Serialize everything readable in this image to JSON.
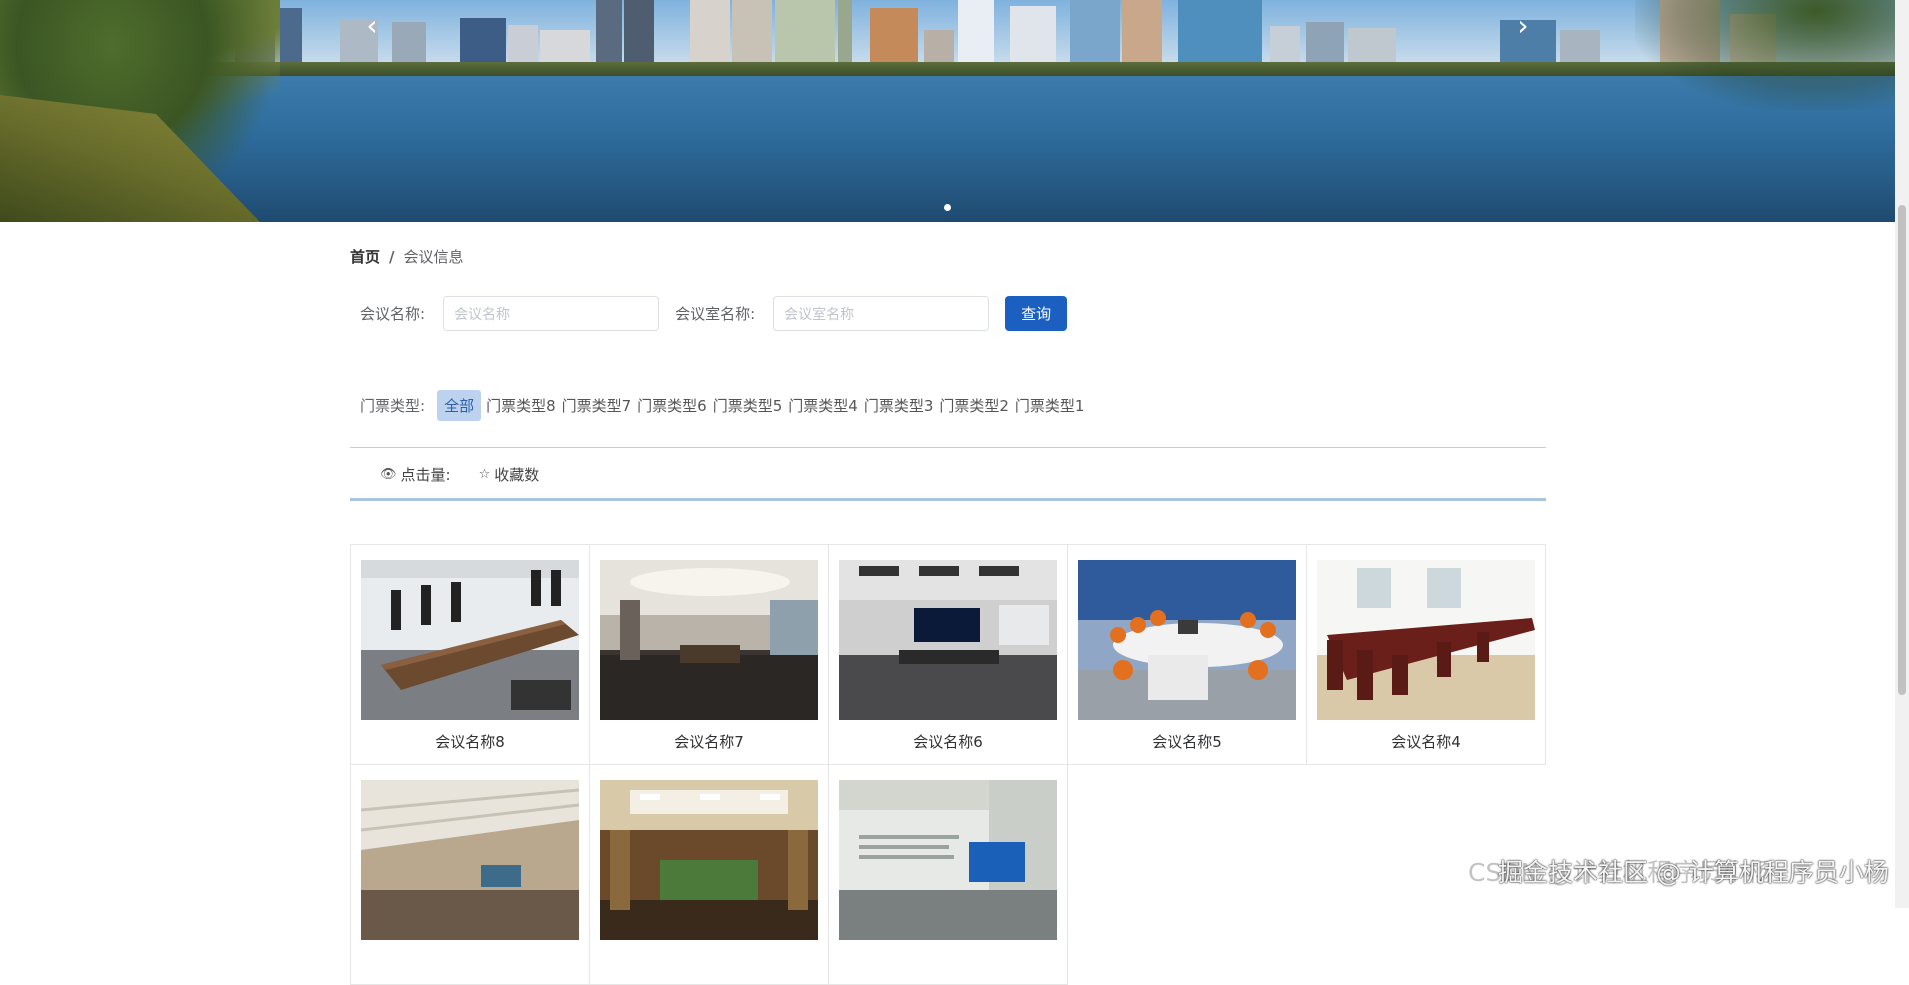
{
  "banner": {
    "prev_icon": "chevron-left-icon",
    "next_icon": "chevron-right-icon",
    "slide_count": 1,
    "active_slide": 1
  },
  "breadcrumb": {
    "home": "首页",
    "separator": "/",
    "current": "会议信息"
  },
  "search": {
    "meeting_name_label": "会议名称:",
    "meeting_name_placeholder": "会议名称",
    "room_name_label": "会议室名称:",
    "room_name_placeholder": "会议室名称",
    "query_button": "查询"
  },
  "filter": {
    "label": "门票类型:",
    "items": [
      "全部",
      "门票类型8",
      "门票类型7",
      "门票类型6",
      "门票类型5",
      "门票类型4",
      "门票类型3",
      "门票类型2",
      "门票类型1"
    ],
    "active": "全部"
  },
  "sort": {
    "clicks": "点击量:",
    "favorites": "收藏数",
    "clicks_icon": "eye-icon",
    "favorites_icon": "star-outline-icon"
  },
  "cards": [
    {
      "name": "会议名称8"
    },
    {
      "name": "会议名称7"
    },
    {
      "name": "会议名称6"
    },
    {
      "name": "会议名称5"
    },
    {
      "name": "会议名称4"
    },
    {
      "name": ""
    },
    {
      "name": ""
    },
    {
      "name": ""
    }
  ],
  "watermark": {
    "text": "掘金技术社区 @ 计算机程序员小杨",
    "shadow": "CSDN @计算机程序员小杨"
  },
  "colors": {
    "primary": "#1b5fc1",
    "active_filter_bg": "#bcd2ee",
    "accent_line": "#a9c4dd"
  }
}
